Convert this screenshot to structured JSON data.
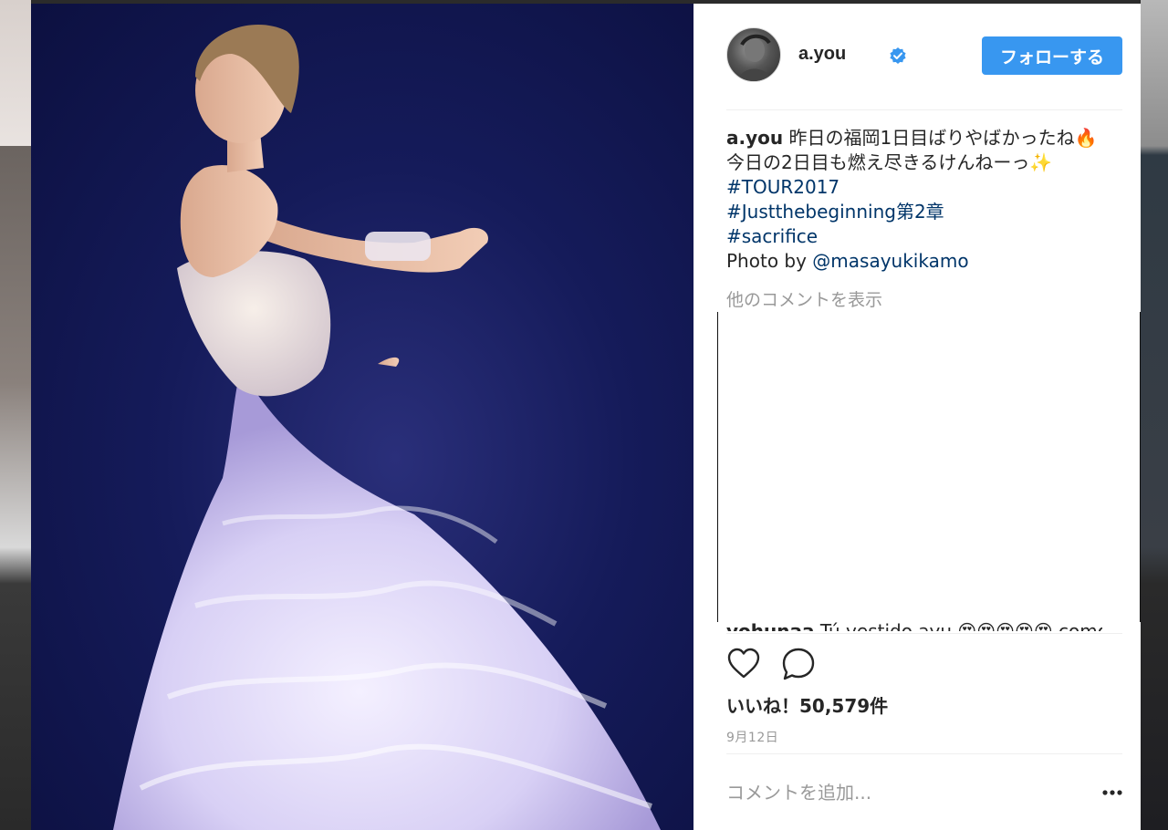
{
  "post": {
    "username": "a.you",
    "follow_label": "フォローする",
    "caption": {
      "line1_text": " 昨日の福岡1日目ばりやばかったね🔥",
      "line2_text": "今日の2日目も燃え尽きるけんねーっ✨",
      "hashtags": [
        "#TOUR2017",
        "#Justthebeginning第2章",
        "#sacrifice"
      ],
      "photo_by_prefix": "Photo by ",
      "photo_by_mention": "@masayukikamo"
    },
    "more_comments_label": "他のコメントを表示",
    "partial_comment": {
      "username": "yohunaa",
      "text": " Tú vestido ayu 😍😍😍😍😍 como"
    },
    "likes_label": "いいね！50,579件",
    "date": "9月12日",
    "comment_placeholder": "コメントを追加..."
  },
  "icons": {
    "verified": "verified-badge-icon",
    "like": "heart-icon",
    "comment": "speech-bubble-icon",
    "more": "ellipsis-icon"
  },
  "colors": {
    "accent": "#3897f0",
    "link": "#003569",
    "text": "#262626",
    "muted": "#999999"
  }
}
